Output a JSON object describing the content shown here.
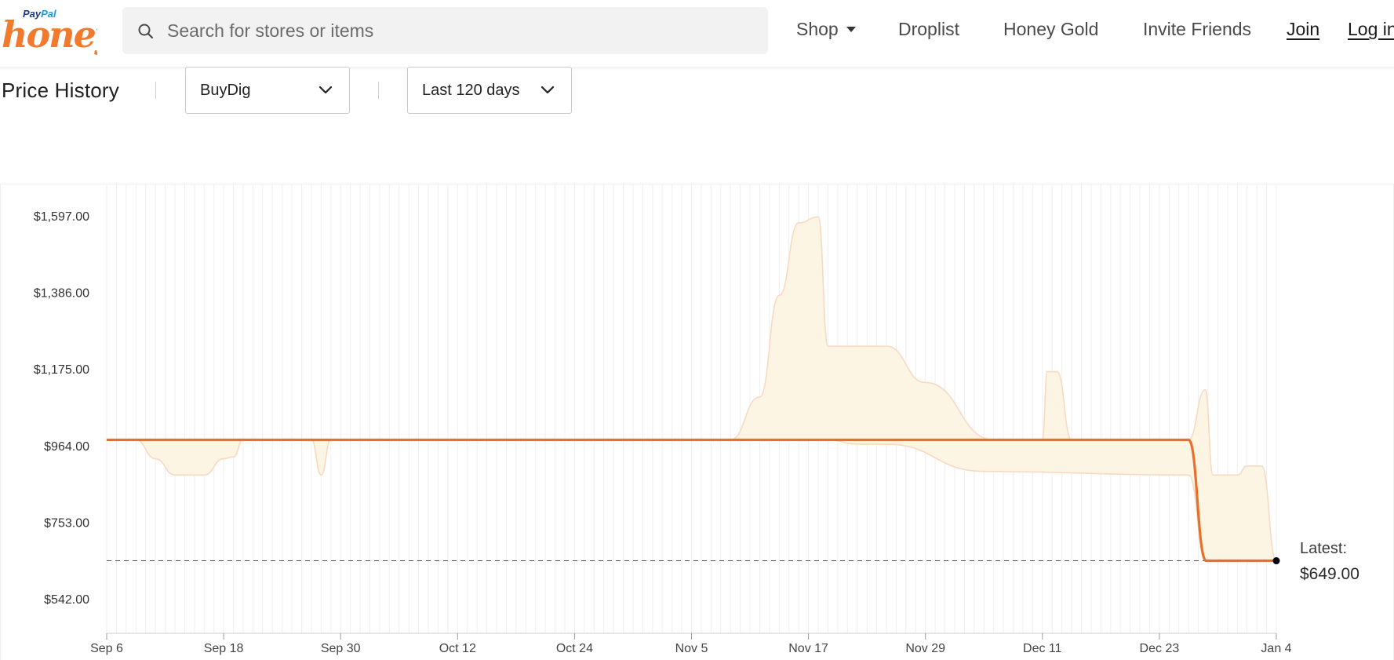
{
  "header": {
    "logo_paypal_a": "Pay",
    "logo_paypal_b": "Pal",
    "logo_word": "honey",
    "search_placeholder": "Search for stores or items",
    "nav": {
      "shop": "Shop",
      "droplist": "Droplist",
      "honey_gold": "Honey Gold",
      "invite": "Invite Friends",
      "join": "Join",
      "login": "Log in"
    }
  },
  "controls": {
    "title": "Price History",
    "store": "BuyDig",
    "range": "Last 120 days"
  },
  "colors": {
    "accent": "#e8702a",
    "band_fill": "#fdf5e4",
    "band_stroke": "#f8d9c2",
    "honey_orange": "#f17a2c"
  },
  "chart_data": {
    "type": "line",
    "x_ticks": [
      "Sep 6",
      "Sep 18",
      "Sep 30",
      "Oct 12",
      "Oct 24",
      "Nov 5",
      "Nov 17",
      "Nov 29",
      "Dec 11",
      "Dec 23",
      "Jan 4"
    ],
    "x_range_days": [
      0,
      120
    ],
    "y_ticks": [
      "$1,597.00",
      "$1,386.00",
      "$1,175.00",
      "$964.00",
      "$753.00",
      "$542.00"
    ],
    "y_values": [
      1597,
      1386,
      1175,
      964,
      753,
      542
    ],
    "ylim": [
      480,
      1680
    ],
    "grid": "vertical daily lines",
    "latest": {
      "label": "Latest:",
      "value": "$649.00",
      "price": 649
    },
    "series": [
      {
        "role": "price",
        "points": [
          [
            0,
            982
          ],
          [
            111,
            982
          ],
          [
            112.8,
            649
          ],
          [
            120,
            649
          ]
        ]
      }
    ],
    "range_band": {
      "upper": [
        [
          0,
          982
        ],
        [
          64,
          982
        ],
        [
          67,
          1100
        ],
        [
          69,
          1380
        ],
        [
          71,
          1580
        ],
        [
          73,
          1596
        ],
        [
          74,
          1240
        ],
        [
          80,
          1240
        ],
        [
          84,
          1140
        ],
        [
          91,
          982
        ],
        [
          96,
          982
        ],
        [
          96.5,
          1170
        ],
        [
          97.5,
          1170
        ],
        [
          99,
          982
        ],
        [
          111,
          982
        ],
        [
          112.7,
          1120
        ],
        [
          113.5,
          885
        ],
        [
          116,
          885
        ],
        [
          117,
          910
        ],
        [
          118.5,
          910
        ],
        [
          120,
          649
        ]
      ],
      "lower": [
        [
          0,
          982
        ],
        [
          3,
          982
        ],
        [
          5,
          930
        ],
        [
          7,
          885
        ],
        [
          10,
          885
        ],
        [
          12,
          930
        ],
        [
          13,
          935
        ],
        [
          14,
          982
        ],
        [
          21,
          982
        ],
        [
          22,
          885
        ],
        [
          23,
          982
        ],
        [
          74,
          982
        ],
        [
          77,
          970
        ],
        [
          80,
          970
        ],
        [
          90,
          895
        ],
        [
          111,
          885
        ],
        [
          112.8,
          649
        ],
        [
          120,
          649
        ]
      ]
    }
  }
}
